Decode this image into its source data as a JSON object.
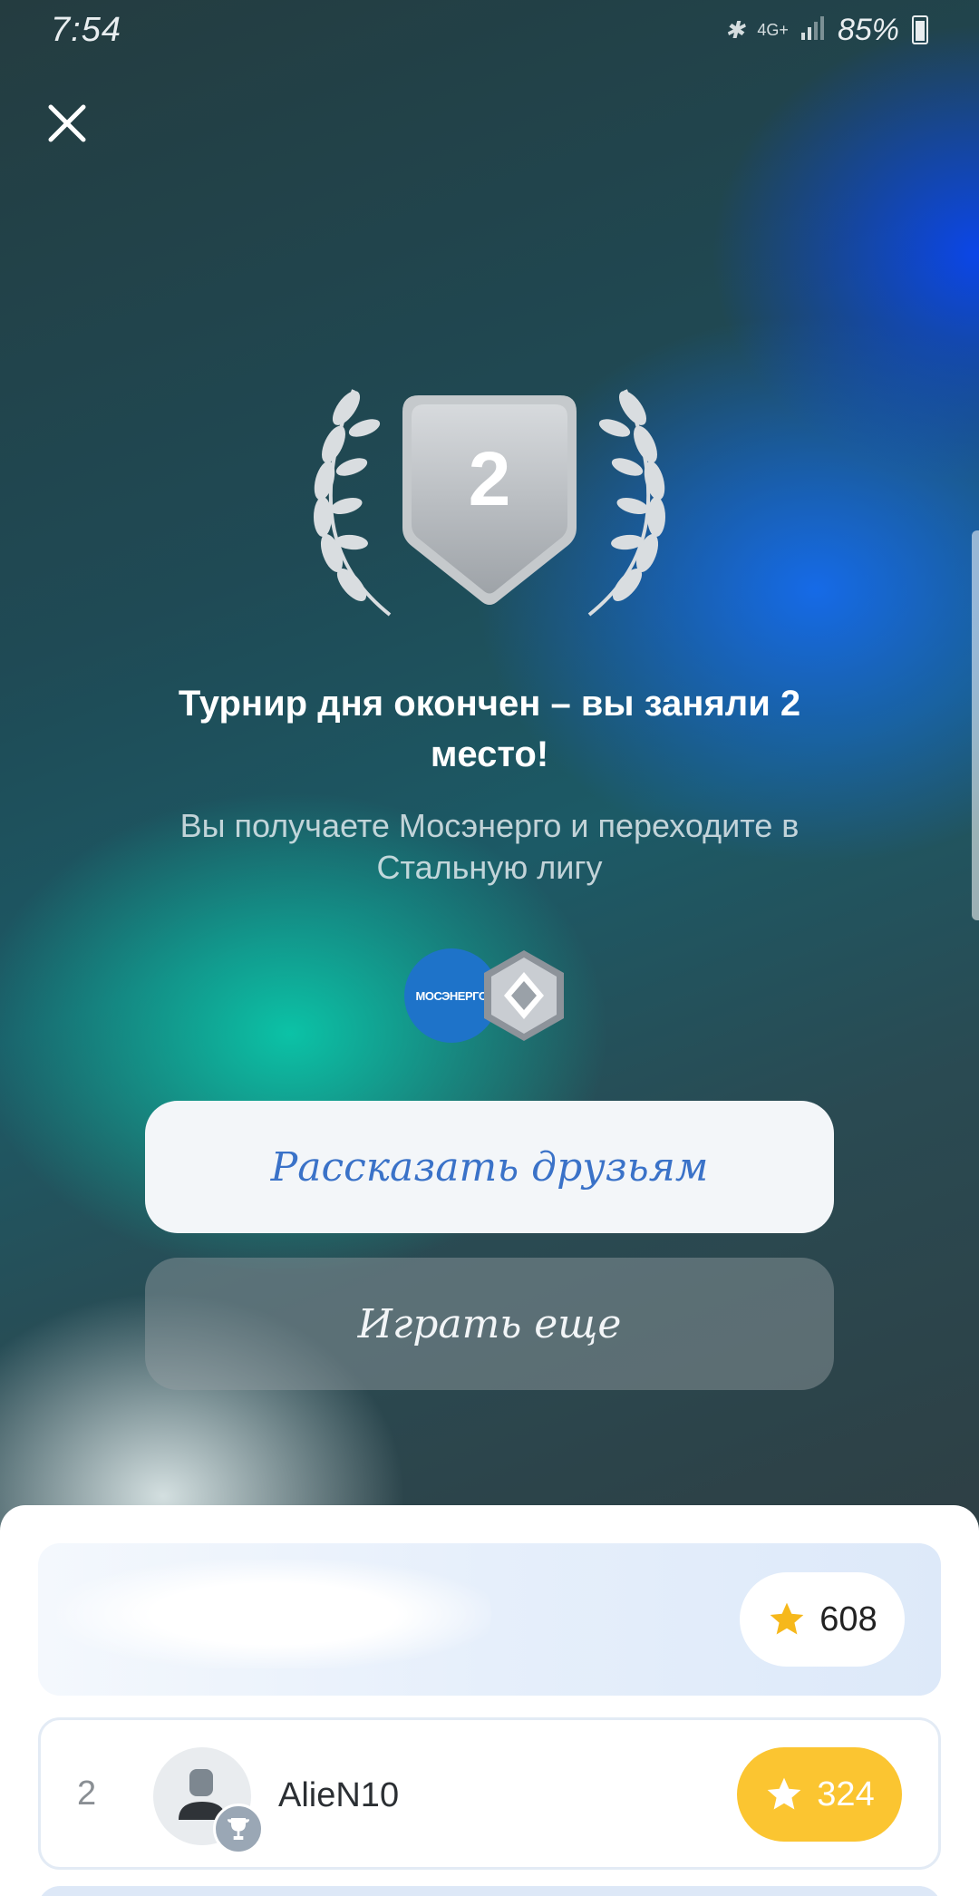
{
  "status_bar": {
    "time": "7:54",
    "network": "4G+",
    "battery": "85%"
  },
  "result": {
    "place": "2",
    "title": "Турнир дня окончен – вы заняли 2 место!",
    "subtitle": "Вы получаете Мосэнерго и переходите в Стальную лигу",
    "reward_logo_text": "МОСЭНЕРГО"
  },
  "buttons": {
    "share_label": "Рассказать друзьям",
    "play_label": "Играть еще"
  },
  "leaderboard": {
    "rows": [
      {
        "rank": "",
        "name": "",
        "score": "608",
        "highlighted": true
      },
      {
        "rank": "2",
        "name": "AlieN10",
        "score": "324",
        "highlighted": false
      }
    ]
  },
  "colors": {
    "share_text": "#3a72c8",
    "score_gold": "#fbc531",
    "star_gold": "#f6b81b"
  },
  "icons": [
    "close-icon",
    "bluetooth-icon",
    "signal-icon",
    "battery-icon",
    "laurel-icon",
    "shield-icon",
    "star-icon",
    "trophy-icon",
    "avatar-icon",
    "steel-league-icon"
  ]
}
